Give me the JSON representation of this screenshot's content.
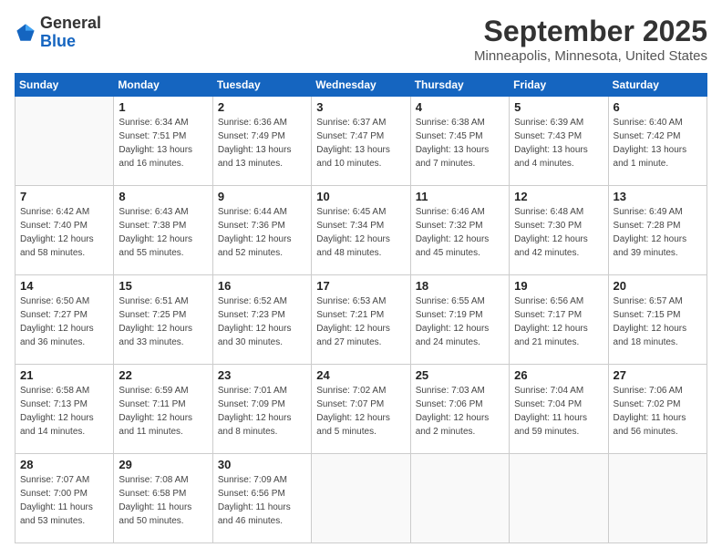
{
  "header": {
    "logo_general": "General",
    "logo_blue": "Blue",
    "month_title": "September 2025",
    "location": "Minneapolis, Minnesota, United States"
  },
  "weekdays": [
    "Sunday",
    "Monday",
    "Tuesday",
    "Wednesday",
    "Thursday",
    "Friday",
    "Saturday"
  ],
  "weeks": [
    [
      {
        "day": "",
        "sunrise": "",
        "sunset": "",
        "daylight": ""
      },
      {
        "day": "1",
        "sunrise": "Sunrise: 6:34 AM",
        "sunset": "Sunset: 7:51 PM",
        "daylight": "Daylight: 13 hours and 16 minutes."
      },
      {
        "day": "2",
        "sunrise": "Sunrise: 6:36 AM",
        "sunset": "Sunset: 7:49 PM",
        "daylight": "Daylight: 13 hours and 13 minutes."
      },
      {
        "day": "3",
        "sunrise": "Sunrise: 6:37 AM",
        "sunset": "Sunset: 7:47 PM",
        "daylight": "Daylight: 13 hours and 10 minutes."
      },
      {
        "day": "4",
        "sunrise": "Sunrise: 6:38 AM",
        "sunset": "Sunset: 7:45 PM",
        "daylight": "Daylight: 13 hours and 7 minutes."
      },
      {
        "day": "5",
        "sunrise": "Sunrise: 6:39 AM",
        "sunset": "Sunset: 7:43 PM",
        "daylight": "Daylight: 13 hours and 4 minutes."
      },
      {
        "day": "6",
        "sunrise": "Sunrise: 6:40 AM",
        "sunset": "Sunset: 7:42 PM",
        "daylight": "Daylight: 13 hours and 1 minute."
      }
    ],
    [
      {
        "day": "7",
        "sunrise": "Sunrise: 6:42 AM",
        "sunset": "Sunset: 7:40 PM",
        "daylight": "Daylight: 12 hours and 58 minutes."
      },
      {
        "day": "8",
        "sunrise": "Sunrise: 6:43 AM",
        "sunset": "Sunset: 7:38 PM",
        "daylight": "Daylight: 12 hours and 55 minutes."
      },
      {
        "day": "9",
        "sunrise": "Sunrise: 6:44 AM",
        "sunset": "Sunset: 7:36 PM",
        "daylight": "Daylight: 12 hours and 52 minutes."
      },
      {
        "day": "10",
        "sunrise": "Sunrise: 6:45 AM",
        "sunset": "Sunset: 7:34 PM",
        "daylight": "Daylight: 12 hours and 48 minutes."
      },
      {
        "day": "11",
        "sunrise": "Sunrise: 6:46 AM",
        "sunset": "Sunset: 7:32 PM",
        "daylight": "Daylight: 12 hours and 45 minutes."
      },
      {
        "day": "12",
        "sunrise": "Sunrise: 6:48 AM",
        "sunset": "Sunset: 7:30 PM",
        "daylight": "Daylight: 12 hours and 42 minutes."
      },
      {
        "day": "13",
        "sunrise": "Sunrise: 6:49 AM",
        "sunset": "Sunset: 7:28 PM",
        "daylight": "Daylight: 12 hours and 39 minutes."
      }
    ],
    [
      {
        "day": "14",
        "sunrise": "Sunrise: 6:50 AM",
        "sunset": "Sunset: 7:27 PM",
        "daylight": "Daylight: 12 hours and 36 minutes."
      },
      {
        "day": "15",
        "sunrise": "Sunrise: 6:51 AM",
        "sunset": "Sunset: 7:25 PM",
        "daylight": "Daylight: 12 hours and 33 minutes."
      },
      {
        "day": "16",
        "sunrise": "Sunrise: 6:52 AM",
        "sunset": "Sunset: 7:23 PM",
        "daylight": "Daylight: 12 hours and 30 minutes."
      },
      {
        "day": "17",
        "sunrise": "Sunrise: 6:53 AM",
        "sunset": "Sunset: 7:21 PM",
        "daylight": "Daylight: 12 hours and 27 minutes."
      },
      {
        "day": "18",
        "sunrise": "Sunrise: 6:55 AM",
        "sunset": "Sunset: 7:19 PM",
        "daylight": "Daylight: 12 hours and 24 minutes."
      },
      {
        "day": "19",
        "sunrise": "Sunrise: 6:56 AM",
        "sunset": "Sunset: 7:17 PM",
        "daylight": "Daylight: 12 hours and 21 minutes."
      },
      {
        "day": "20",
        "sunrise": "Sunrise: 6:57 AM",
        "sunset": "Sunset: 7:15 PM",
        "daylight": "Daylight: 12 hours and 18 minutes."
      }
    ],
    [
      {
        "day": "21",
        "sunrise": "Sunrise: 6:58 AM",
        "sunset": "Sunset: 7:13 PM",
        "daylight": "Daylight: 12 hours and 14 minutes."
      },
      {
        "day": "22",
        "sunrise": "Sunrise: 6:59 AM",
        "sunset": "Sunset: 7:11 PM",
        "daylight": "Daylight: 12 hours and 11 minutes."
      },
      {
        "day": "23",
        "sunrise": "Sunrise: 7:01 AM",
        "sunset": "Sunset: 7:09 PM",
        "daylight": "Daylight: 12 hours and 8 minutes."
      },
      {
        "day": "24",
        "sunrise": "Sunrise: 7:02 AM",
        "sunset": "Sunset: 7:07 PM",
        "daylight": "Daylight: 12 hours and 5 minutes."
      },
      {
        "day": "25",
        "sunrise": "Sunrise: 7:03 AM",
        "sunset": "Sunset: 7:06 PM",
        "daylight": "Daylight: 12 hours and 2 minutes."
      },
      {
        "day": "26",
        "sunrise": "Sunrise: 7:04 AM",
        "sunset": "Sunset: 7:04 PM",
        "daylight": "Daylight: 11 hours and 59 minutes."
      },
      {
        "day": "27",
        "sunrise": "Sunrise: 7:06 AM",
        "sunset": "Sunset: 7:02 PM",
        "daylight": "Daylight: 11 hours and 56 minutes."
      }
    ],
    [
      {
        "day": "28",
        "sunrise": "Sunrise: 7:07 AM",
        "sunset": "Sunset: 7:00 PM",
        "daylight": "Daylight: 11 hours and 53 minutes."
      },
      {
        "day": "29",
        "sunrise": "Sunrise: 7:08 AM",
        "sunset": "Sunset: 6:58 PM",
        "daylight": "Daylight: 11 hours and 50 minutes."
      },
      {
        "day": "30",
        "sunrise": "Sunrise: 7:09 AM",
        "sunset": "Sunset: 6:56 PM",
        "daylight": "Daylight: 11 hours and 46 minutes."
      },
      {
        "day": "",
        "sunrise": "",
        "sunset": "",
        "daylight": ""
      },
      {
        "day": "",
        "sunrise": "",
        "sunset": "",
        "daylight": ""
      },
      {
        "day": "",
        "sunrise": "",
        "sunset": "",
        "daylight": ""
      },
      {
        "day": "",
        "sunrise": "",
        "sunset": "",
        "daylight": ""
      }
    ]
  ]
}
